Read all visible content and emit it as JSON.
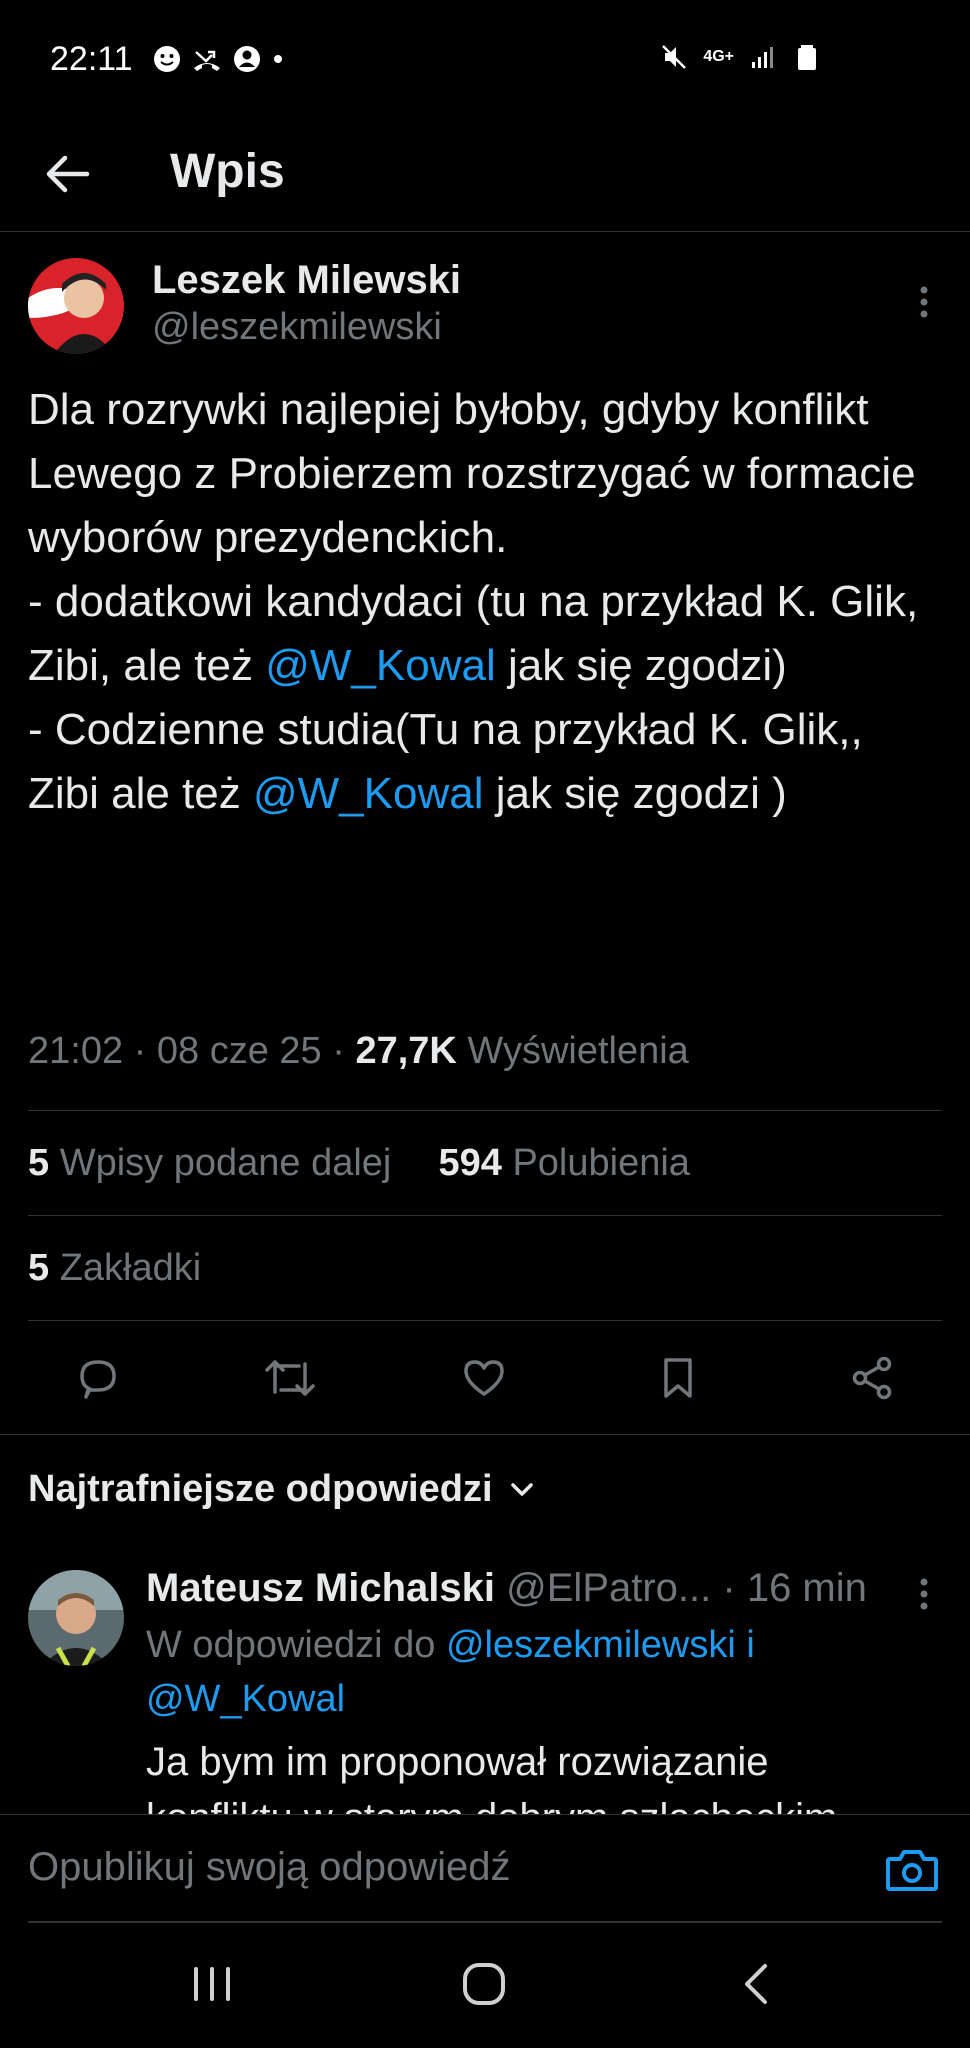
{
  "status_bar": {
    "time": "22:11",
    "network": "4G+"
  },
  "header": {
    "title": "Wpis"
  },
  "tweet": {
    "author_name": "Leszek Milewski",
    "author_handle": "@leszekmilewski",
    "text_parts": [
      "Dla rozrywki najlepiej byłoby, gdyby konflikt Lewego z Probierzem rozstrzygać w formacie wyborów prezydenckich.\n- dodatkowi kandydaci (tu na przykład K. Glik, Zibi, ale też ",
      "@W_Kowal",
      " jak się zgodzi)\n- Codzienne studia(Tu na przykład K. Glik,, Zibi ale też ",
      "@W_Kowal",
      " jak się zgodzi )"
    ],
    "time": "21:02",
    "date": "08 cze 25",
    "views_count": "27,7K",
    "views_label": "Wyświetlenia",
    "reposts_count": "5",
    "reposts_label": "Wpisy podane dalej",
    "likes_count": "594",
    "likes_label": "Polubienia",
    "bookmarks_count": "5",
    "bookmarks_label": "Zakładki"
  },
  "replies": {
    "heading": "Najtrafniejsze odpowiedzi",
    "items": [
      {
        "author_name": "Mateusz Michalski",
        "author_handle": "@ElPatro...",
        "time": "· 16 min",
        "reply_to_prefix": "W odpowiedzi do",
        "reply_to_users": "@leszekmilewski i @W_Kowal",
        "text": "Ja bym im proponował rozwiązanie konfliktu w starym dobrym szlacheckim"
      }
    ]
  },
  "compose": {
    "placeholder": "Opublikuj swoją odpowiedź"
  },
  "colors": {
    "accent": "#1d9bf0",
    "background": "#000000",
    "muted": "#71767b",
    "text": "#e7e9ea"
  }
}
